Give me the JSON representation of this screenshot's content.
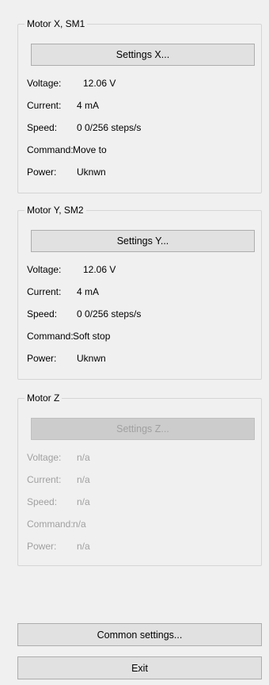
{
  "motors": [
    {
      "title": "Motor X, SM1",
      "settings_label": "Settings X...",
      "fields": [
        {
          "label": "Voltage:",
          "value": "12.06 V"
        },
        {
          "label": "Current:",
          "value": "4 mA"
        },
        {
          "label": "Speed:",
          "value": "0 0/256 steps/s"
        },
        {
          "label": "Command:",
          "value": "Move to"
        },
        {
          "label": "Power:",
          "value": "Uknwn"
        }
      ]
    },
    {
      "title": "Motor Y, SM2",
      "settings_label": "Settings Y...",
      "fields": [
        {
          "label": "Voltage:",
          "value": "12.06 V"
        },
        {
          "label": "Current:",
          "value": "4 mA"
        },
        {
          "label": "Speed:",
          "value": "0 0/256 steps/s"
        },
        {
          "label": "Command:",
          "value": "Soft stop"
        },
        {
          "label": "Power:",
          "value": "Uknwn"
        }
      ]
    },
    {
      "title": "Motor Z",
      "settings_label": "Settings Z...",
      "fields": [
        {
          "label": "Voltage:",
          "value": "n/a"
        },
        {
          "label": "Current:",
          "value": "n/a"
        },
        {
          "label": "Speed:",
          "value": "n/a"
        },
        {
          "label": "Command:",
          "value": "n/a"
        },
        {
          "label": "Power:",
          "value": "n/a"
        }
      ]
    }
  ],
  "buttons": {
    "common_settings": "Common settings...",
    "exit": "Exit"
  }
}
